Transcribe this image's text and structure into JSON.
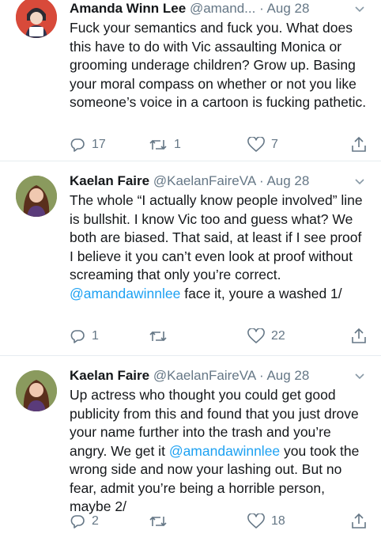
{
  "tweets": [
    {
      "name": "Amanda Winn Lee",
      "handle": "@amand...",
      "date": "Aug 28",
      "text": "Fuck your semantics and fuck you. What does this have to do with Vic assaulting Monica or grooming underage children? Grow up. Basing your moral compass on whether or not you like someone’s voice in a cartoon is fucking pathetic.",
      "replies": "17",
      "retweets": "1",
      "likes": "7"
    },
    {
      "name": "Kaelan Faire",
      "handle": "@KaelanFaireVA",
      "date": "Aug 28",
      "text_before": "The whole “I actually know people involved” line is bullshit. I know Vic too and guess what? We both are biased. That said, at least if I see proof I believe it you can’t even look at proof without screaming that only you’re correct. ",
      "mention": "@amandawinnlee",
      "text_after": " face it, youre a washed 1/",
      "replies": "1",
      "retweets": "",
      "likes": "22"
    },
    {
      "name": "Kaelan Faire",
      "handle": "@KaelanFaireVA",
      "date": "Aug 28",
      "text_before": "Up actress who thought you could get good publicity from this and found that you just drove your name further into the trash and you’re angry. We get it ",
      "mention": "@amandawinnlee",
      "text_after": " you took the wrong side and now your lashing out. But no fear, admit you’re being a horrible person, maybe 2/",
      "replies": "2",
      "retweets": "",
      "likes": "18"
    }
  ],
  "separator": "·",
  "icons": {
    "reply": "reply-icon",
    "retweet": "retweet-icon",
    "like": "heart-icon",
    "share": "share-icon",
    "menu": "chevron-down-icon"
  },
  "colors": {
    "text": "#14171a",
    "muted": "#657786",
    "link": "#1da1f2"
  }
}
